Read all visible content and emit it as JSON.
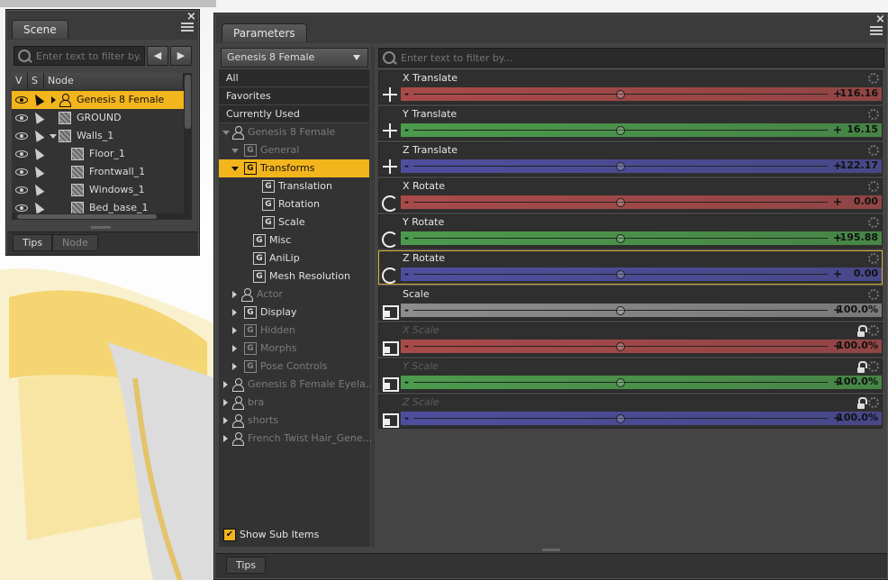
{
  "scene": {
    "tab": "Scene",
    "filter_placeholder": "Enter text to filter by...",
    "columns": [
      "V",
      "S",
      "Node"
    ],
    "nodes": [
      {
        "label": "Genesis 8 Female",
        "selected": true,
        "expander": "collapsed"
      },
      {
        "label": "GROUND"
      },
      {
        "label": "Walls_1",
        "expander": "expanded"
      },
      {
        "label": "Floor_1"
      },
      {
        "label": "Frontwall_1"
      },
      {
        "label": "Windows_1"
      },
      {
        "label": "Bed_base_1"
      }
    ],
    "bottom_tabs": [
      "Tips",
      "Node"
    ]
  },
  "params": {
    "tab": "Parameters",
    "figure_select": "Genesis 8 Female",
    "filter_placeholder": "Enter text to filter by...",
    "tree": [
      {
        "label": "All"
      },
      {
        "label": "Favorites"
      },
      {
        "label": "Currently Used"
      },
      {
        "label": "Genesis 8 Female"
      },
      {
        "label": "General"
      },
      {
        "label": "Transforms",
        "selected": true
      },
      {
        "label": "Translation"
      },
      {
        "label": "Rotation"
      },
      {
        "label": "Scale"
      },
      {
        "label": "Misc"
      },
      {
        "label": "AniLip"
      },
      {
        "label": "Mesh Resolution"
      },
      {
        "label": "Actor"
      },
      {
        "label": "Display"
      },
      {
        "label": "Hidden"
      },
      {
        "label": "Morphs"
      },
      {
        "label": "Pose Controls"
      },
      {
        "label": "Genesis 8 Female Eyela..."
      },
      {
        "label": "bra"
      },
      {
        "label": "shorts"
      },
      {
        "label": "French Twist Hair_Gene..."
      }
    ],
    "show_sub_items": "Show Sub Items",
    "sliders": [
      {
        "label": "X Translate",
        "value": "116.16",
        "pos": 0.5,
        "color": "#a94a4a",
        "icon": "move"
      },
      {
        "label": "Y Translate",
        "value": "16.15",
        "pos": 0.5,
        "color": "#4c9a4c",
        "icon": "move"
      },
      {
        "label": "Z Translate",
        "value": "-122.17",
        "pos": 0.5,
        "color": "#4e4e9e",
        "icon": "move"
      },
      {
        "label": "X Rotate",
        "value": "0.00",
        "pos": 0.5,
        "color": "#a94a4a",
        "icon": "rotate"
      },
      {
        "label": "Y Rotate",
        "value": "-195.88",
        "pos": 0.5,
        "color": "#4c9a4c",
        "icon": "rotate"
      },
      {
        "label": "Z Rotate",
        "value": "0.00",
        "pos": 0.5,
        "color": "#4e4e9e",
        "icon": "rotate",
        "highlight": true
      },
      {
        "label": "Scale",
        "value": "100.0%",
        "pos": 0.5,
        "color": "#8c8c8c",
        "icon": "scale"
      },
      {
        "label": "X Scale",
        "value": "100.0%",
        "pos": 0.5,
        "color": "#a94a4a",
        "icon": "scale",
        "dim": true,
        "lock": true
      },
      {
        "label": "Y Scale",
        "value": "100.0%",
        "pos": 0.5,
        "color": "#4c9a4c",
        "icon": "scale",
        "dim": true,
        "lock": true
      },
      {
        "label": "Z Scale",
        "value": "100.0%",
        "pos": 0.5,
        "color": "#4e4e9e",
        "icon": "scale",
        "dim": true,
        "lock": true
      }
    ],
    "bottom_tab": "Tips"
  }
}
